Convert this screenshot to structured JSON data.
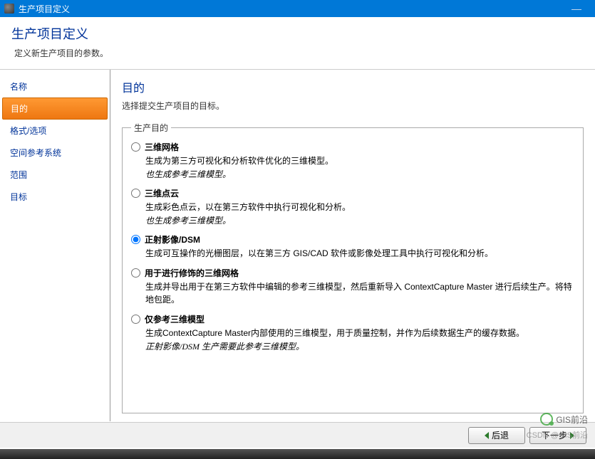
{
  "window": {
    "title": "生产项目定义",
    "minimize": "—"
  },
  "header": {
    "title": "生产项目定义",
    "subtitle": "定义新生产项目的参数。"
  },
  "sidebar": {
    "items": [
      {
        "label": "名称"
      },
      {
        "label": "目的"
      },
      {
        "label": "格式/选项"
      },
      {
        "label": "空间参考系统"
      },
      {
        "label": "范围"
      },
      {
        "label": "目标"
      }
    ],
    "active_index": 1
  },
  "main": {
    "title": "目的",
    "subtitle": "选择提交生产项目的目标。",
    "group_label": "生产目的",
    "selected_index": 2,
    "options": [
      {
        "label": "三维网格",
        "desc": "生成为第三方可视化和分析软件优化的三维模型。",
        "note": "也生成参考三维模型。"
      },
      {
        "label": "三维点云",
        "desc": "生成彩色点云，以在第三方软件中执行可视化和分析。",
        "note": "也生成参考三维模型。"
      },
      {
        "label": "正射影像/DSM",
        "desc": "生成可互操作的光栅图层，以在第三方 GIS/CAD 软件或影像处理工具中执行可视化和分析。",
        "note": ""
      },
      {
        "label": "用于进行修饰的三维网格",
        "desc": "生成并导出用于在第三方软件中编辑的参考三维模型，然后重新导入 ContextCapture Master 进行后续生产。将特地包距。",
        "note": ""
      },
      {
        "label": "仅参考三维模型",
        "desc": "生成ContextCapture Master内部使用的三维模型，用于质量控制，并作为后续数据生产的缓存数据。",
        "note": "正射影像/DSM 生产需要此参考三维模型。"
      }
    ]
  },
  "footer": {
    "back": "后退",
    "next": "下一步"
  },
  "watermark": {
    "line1": "GIS前沿",
    "line2": "CSDN @GIS前沿"
  }
}
